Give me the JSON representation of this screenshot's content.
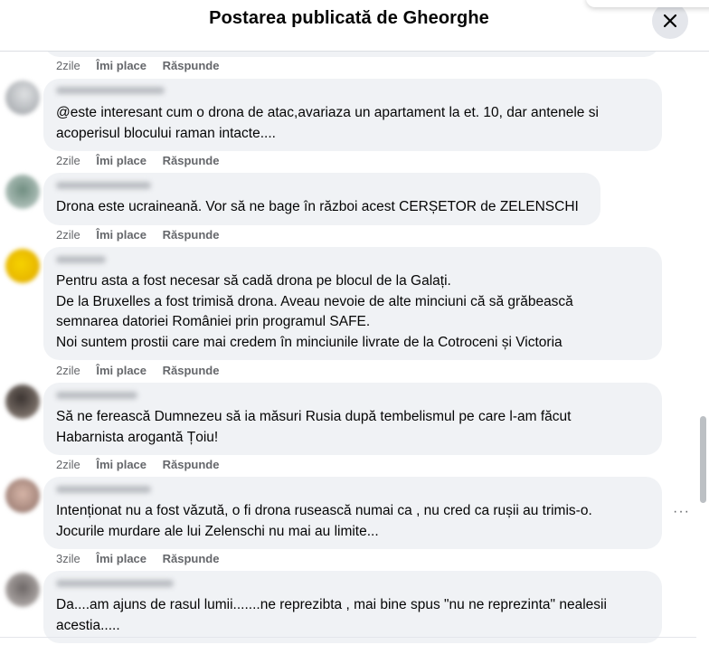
{
  "header": {
    "title": "Postarea publicată de Gheorghe"
  },
  "actions": {
    "like": "Îmi place",
    "reply": "Răspunde"
  },
  "first_row": {
    "time": "2zile"
  },
  "comments": [
    {
      "text": "@este interesant cum o drona de atac,avariaza un apartament la et. 10, dar antenele si\nacoperisul blocului raman intacte....",
      "time": "2zile"
    },
    {
      "text": "Drona este ucraineană. Vor să ne bage în război acest CERȘETOR de ZELENSCHI",
      "time": "2zile"
    },
    {
      "text": "Pentru asta a fost necesar să cadă drona pe blocul de la Galați.\nDe la Bruxelles a fost trimisă drona. Aveau nevoie de alte minciuni că să grăbească\nsemnarea datoriei României prin programul SAFE.\nNoi suntem prostii care mai credem în minciunile livrate de la Cotroceni și Victoria",
      "time": "2zile"
    },
    {
      "text": "Să ne ferească Dumnezeu să ia măsuri Rusia după tembelismul pe care l-am făcut\nHabarnista arogantă Țoiu!",
      "time": "2zile"
    },
    {
      "text": "Intenționat nu a fost văzută, o fi drona rusească numai ca , nu cred ca rușii au trimis-o.\nJocurile murdare ale lui Zelenschi nu mai au limite...",
      "time": "3zile"
    },
    {
      "text": "Da....am ajuns de rasul lumii.......ne reprezibta , mai bine spus \"nu ne reprezinta\" nealesii\nacestia.....",
      "time": ""
    }
  ],
  "icons": {
    "close": "close-icon",
    "more": "more-options-icon"
  },
  "colors": {
    "bubble": "#f0f2f5",
    "meta_text": "#65676b",
    "close_bg": "#e4e6eb"
  }
}
